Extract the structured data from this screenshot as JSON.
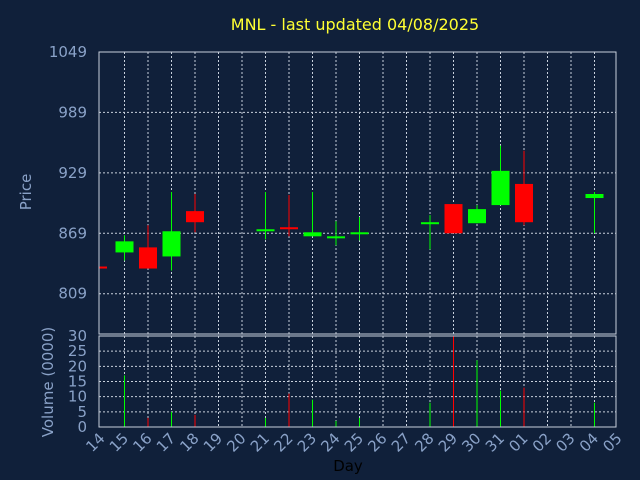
{
  "chart_data": {
    "type": "candlestick",
    "title": "MNL - last updated 04/08/2025",
    "xlabel": "Day",
    "ylabel": "Price",
    "volume_label": "Volume (0000)",
    "grid": true,
    "colors": {
      "up": "#00ff00",
      "down": "#ff0000",
      "background": "#10203a",
      "title": "#ffff33",
      "text": "#8aa2c8"
    },
    "x_ticks": [
      "14",
      "15",
      "16",
      "17",
      "18",
      "19",
      "20",
      "21",
      "22",
      "23",
      "24",
      "25",
      "26",
      "27",
      "28",
      "29",
      "30",
      "31",
      "01",
      "02",
      "03",
      "04",
      "05"
    ],
    "price_ticks": [
      809,
      869,
      929,
      989,
      1049
    ],
    "price_range": [
      769,
      1049
    ],
    "volume_ticks": [
      0,
      5,
      10,
      15,
      20,
      25,
      30
    ],
    "volume_range": [
      0,
      30
    ],
    "candles": [
      {
        "day": "14",
        "open": 836,
        "close": 834,
        "high": 836,
        "low": 834,
        "volume": 0
      },
      {
        "day": "15",
        "open": 850,
        "close": 861,
        "high": 867,
        "low": 842,
        "volume": 17
      },
      {
        "day": "16",
        "open": 855,
        "close": 834,
        "high": 877,
        "low": 834,
        "volume": 3
      },
      {
        "day": "17",
        "open": 846,
        "close": 871,
        "high": 910,
        "low": 832,
        "volume": 5
      },
      {
        "day": "18",
        "open": 891,
        "close": 880,
        "high": 908,
        "low": 870,
        "volume": 4
      },
      {
        "day": "21",
        "open": 872,
        "close": 873,
        "high": 910,
        "low": 863,
        "volume": 3
      },
      {
        "day": "22",
        "open": 875,
        "close": 874,
        "high": 907,
        "low": 866,
        "volume": 11
      },
      {
        "day": "23",
        "open": 866,
        "close": 870,
        "high": 910,
        "low": 866,
        "volume": 9
      },
      {
        "day": "24",
        "open": 864,
        "close": 866,
        "high": 881,
        "low": 857,
        "volume": 2
      },
      {
        "day": "25",
        "open": 869,
        "close": 870,
        "high": 885,
        "low": 862,
        "volume": 3
      },
      {
        "day": "28",
        "open": 879,
        "close": 880,
        "high": 887,
        "low": 853,
        "volume": 8
      },
      {
        "day": "29",
        "open": 898,
        "close": 869,
        "high": 898,
        "low": 869,
        "volume": 30
      },
      {
        "day": "30",
        "open": 879,
        "close": 893,
        "high": 897,
        "low": 879,
        "volume": 22
      },
      {
        "day": "31",
        "open": 897,
        "close": 931,
        "high": 956,
        "low": 897,
        "volume": 12
      },
      {
        "day": "01",
        "open": 918,
        "close": 880,
        "high": 951,
        "low": 877,
        "volume": 13
      },
      {
        "day": "04",
        "open": 904,
        "close": 908,
        "high": 910,
        "low": 869,
        "volume": 8
      }
    ]
  }
}
